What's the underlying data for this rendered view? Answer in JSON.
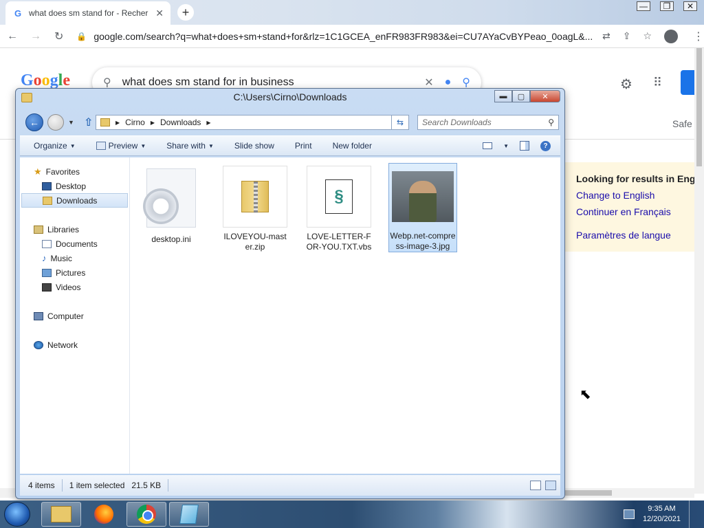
{
  "chrome": {
    "tab_title": "what does sm stand for - Recher",
    "tab_close": "✕",
    "new_tab": "+",
    "url": "google.com/search?q=what+does+sm+stand+for&rlz=1C1GCEA_enFR983FR983&ei=CU7AYaCvBYPeao_0oagL&...",
    "back": "←",
    "forward": "→",
    "reload": "↻",
    "win_min": "—",
    "win_max": "❐",
    "win_close": "✕"
  },
  "google": {
    "logo": [
      "G",
      "o",
      "o",
      "g",
      "l",
      "e"
    ],
    "query": "what does sm stand for in business",
    "clear": "✕",
    "mic": "🎤",
    "search_glyph": "⚲",
    "safe_label": "Safe",
    "lang_panel": {
      "heading": "Looking for results in Engli",
      "link_english": "Change to English",
      "link_french": "Continuer en Français",
      "link_settings": "Paramètres de langue"
    }
  },
  "explorer": {
    "title": "C:\\Users\\Cirno\\Downloads",
    "breadcrumb": [
      "Cirno",
      "Downloads"
    ],
    "search_placeholder": "Search Downloads",
    "commands": {
      "organize": "Organize",
      "preview": "Preview",
      "share_with": "Share with",
      "slide_show": "Slide show",
      "print": "Print",
      "new_folder": "New folder"
    },
    "nav": {
      "favorites": "Favorites",
      "desktop": "Desktop",
      "downloads": "Downloads",
      "libraries": "Libraries",
      "documents": "Documents",
      "music": "Music",
      "pictures": "Pictures",
      "videos": "Videos",
      "computer": "Computer",
      "network": "Network"
    },
    "files": [
      {
        "name": "desktop.ini",
        "icon": "settings-file-icon"
      },
      {
        "name": "ILOVEYOU-master.zip",
        "icon": "zip-folder-icon"
      },
      {
        "name": "LOVE-LETTER-FOR-YOU.TXT.vbs",
        "icon": "vbs-script-icon"
      },
      {
        "name": "Webp.net-compress-image-3.jpg",
        "icon": "image-thumbnail",
        "selected": true
      }
    ],
    "status": {
      "item_count": "4 items",
      "selection": "1 item selected",
      "size": "21.5 KB"
    }
  },
  "taskbar": {
    "time": "9:35 AM",
    "date": "12/20/2021"
  }
}
